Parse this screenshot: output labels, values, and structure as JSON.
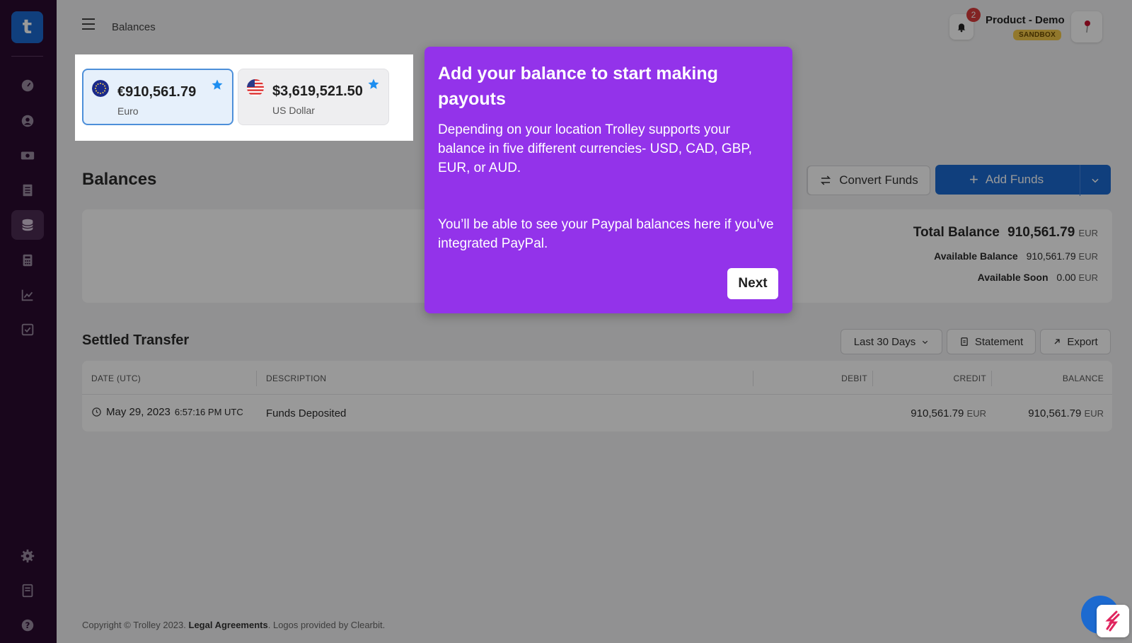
{
  "app": {
    "logo_letter": "t",
    "breadcrumb": "Balances"
  },
  "header": {
    "notification_count": "2",
    "account_name": "Product - Demo",
    "environment_badge": "SANDBOX"
  },
  "currency_cards": [
    {
      "amount": "€910,561.79",
      "name": "Euro",
      "flag": "eu-flag-icon",
      "favorite": true,
      "selected": true
    },
    {
      "amount": "$3,619,521.50",
      "name": "US Dollar",
      "flag": "us-flag-icon",
      "favorite": true,
      "selected": false
    }
  ],
  "balances": {
    "title": "Balances",
    "convert_label": "Convert Funds",
    "add_funds_label": "Add Funds",
    "total_label": "Total Balance",
    "total_value": "910,561.79",
    "total_currency": "EUR",
    "available_label": "Available Balance",
    "available_value": "910,561.79",
    "available_currency": "EUR",
    "soon_label": "Available Soon",
    "soon_value": "0.00",
    "soon_currency": "EUR"
  },
  "transfers": {
    "title": "Settled Transfer",
    "range_label": "Last 30 Days",
    "statement_label": "Statement",
    "export_label": "Export",
    "columns": [
      "DATE (UTC)",
      "DESCRIPTION",
      "DEBIT",
      "CREDIT",
      "BALANCE"
    ],
    "rows": [
      {
        "date": "May 29, 2023",
        "time": "6:57:16 PM UTC",
        "description": "Funds Deposited",
        "debit": "",
        "credit": "910,561.79",
        "credit_currency": "EUR",
        "balance": "910,561.79",
        "balance_currency": "EUR"
      }
    ]
  },
  "footer": {
    "copyright": "Copyright © Trolley 2023.",
    "legal": "Legal Agreements",
    "logos": ". Logos provided by Clearbit."
  },
  "tour": {
    "title": "Add your balance to start making payouts",
    "paragraph1": "Depending on your location Trolley supports your balance in five different currencies- USD, CAD, GBP, EUR, or AUD.",
    "paragraph2": "You’ll be able to see your Paypal balances here if you’ve integrated PayPal.",
    "next_label": "Next"
  },
  "colors": {
    "sidebar": "#2a0a30",
    "primary": "#1c6ad0",
    "tour": "#9333ea",
    "badge": "#d93b3b",
    "sandbox": "#f3c94a"
  }
}
